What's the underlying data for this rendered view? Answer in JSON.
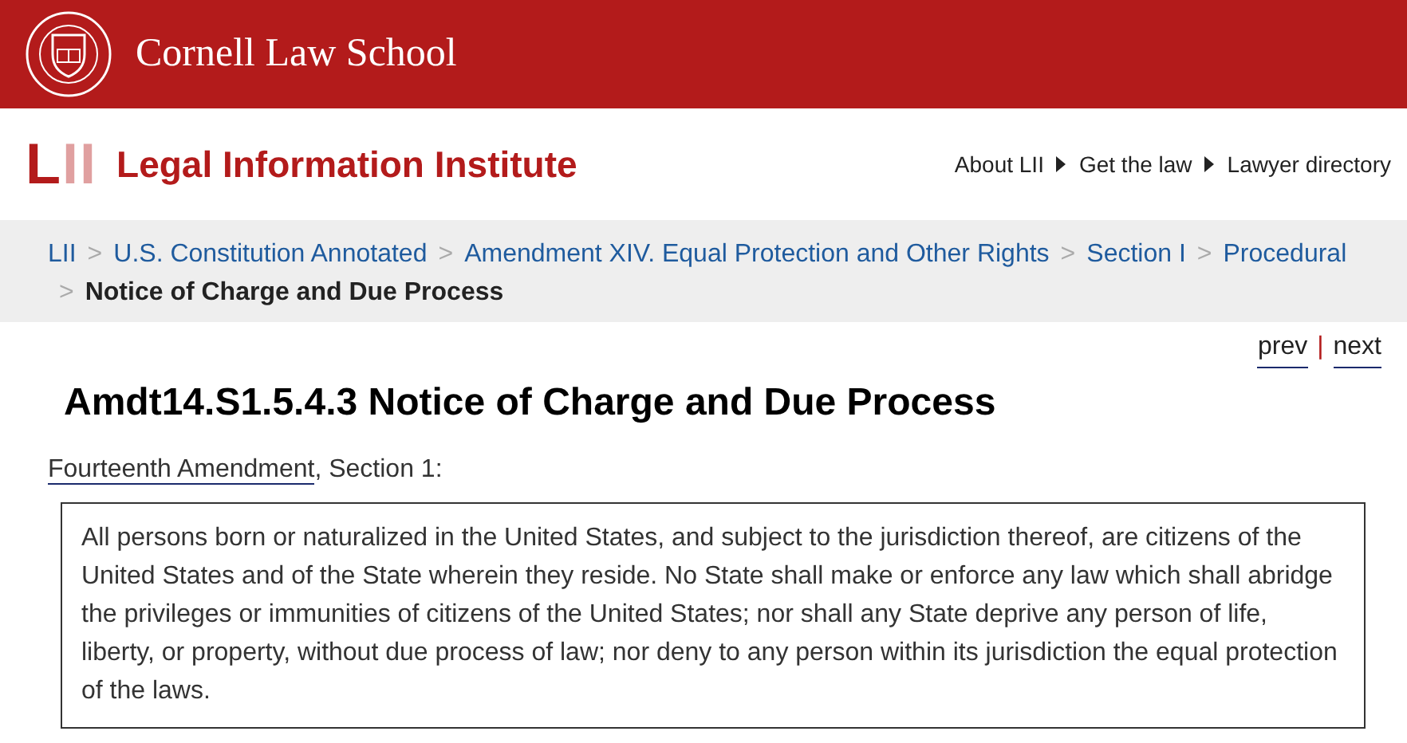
{
  "header": {
    "school": "Cornell Law School"
  },
  "brand": {
    "logo": "LII",
    "name": "Legal Information Institute"
  },
  "top_nav": [
    {
      "label": "About LII",
      "caret": true
    },
    {
      "label": "Get the law",
      "caret": true
    },
    {
      "label": "Lawyer directory",
      "caret": false
    }
  ],
  "breadcrumb": [
    {
      "label": "LII",
      "current": false
    },
    {
      "separator": ">",
      "label": "U.S. Constitution Annotated",
      "current": false
    },
    {
      "separator": ">",
      "label": "Amendment XIV. Equal Protection and Other Rights",
      "current": false
    },
    {
      "separator": ">",
      "label": "Section I",
      "current": false
    },
    {
      "separator": ">",
      "label": "Procedural",
      "current": false
    },
    {
      "separator": ">",
      "label": "Notice of Charge and Due Process",
      "current": true
    }
  ],
  "pager": {
    "prev": "prev",
    "divider": "|",
    "next": "next"
  },
  "title": "Amdt14.S1.5.4.3 Notice of Charge and Due Process",
  "source": {
    "link": "Fourteenth Amendment",
    "rest": ", Section 1:"
  },
  "quote": "All persons born or naturalized in the United States, and subject to the jurisdiction thereof, are citizens of the United States and of the State wherein they reside. No State shall make or enforce any law which shall abridge the privileges or immunities of citizens of the United States; nor shall any State deprive any person of life, liberty, or property, without due process of law; nor deny to any person within its jurisdiction the equal protection of the laws."
}
